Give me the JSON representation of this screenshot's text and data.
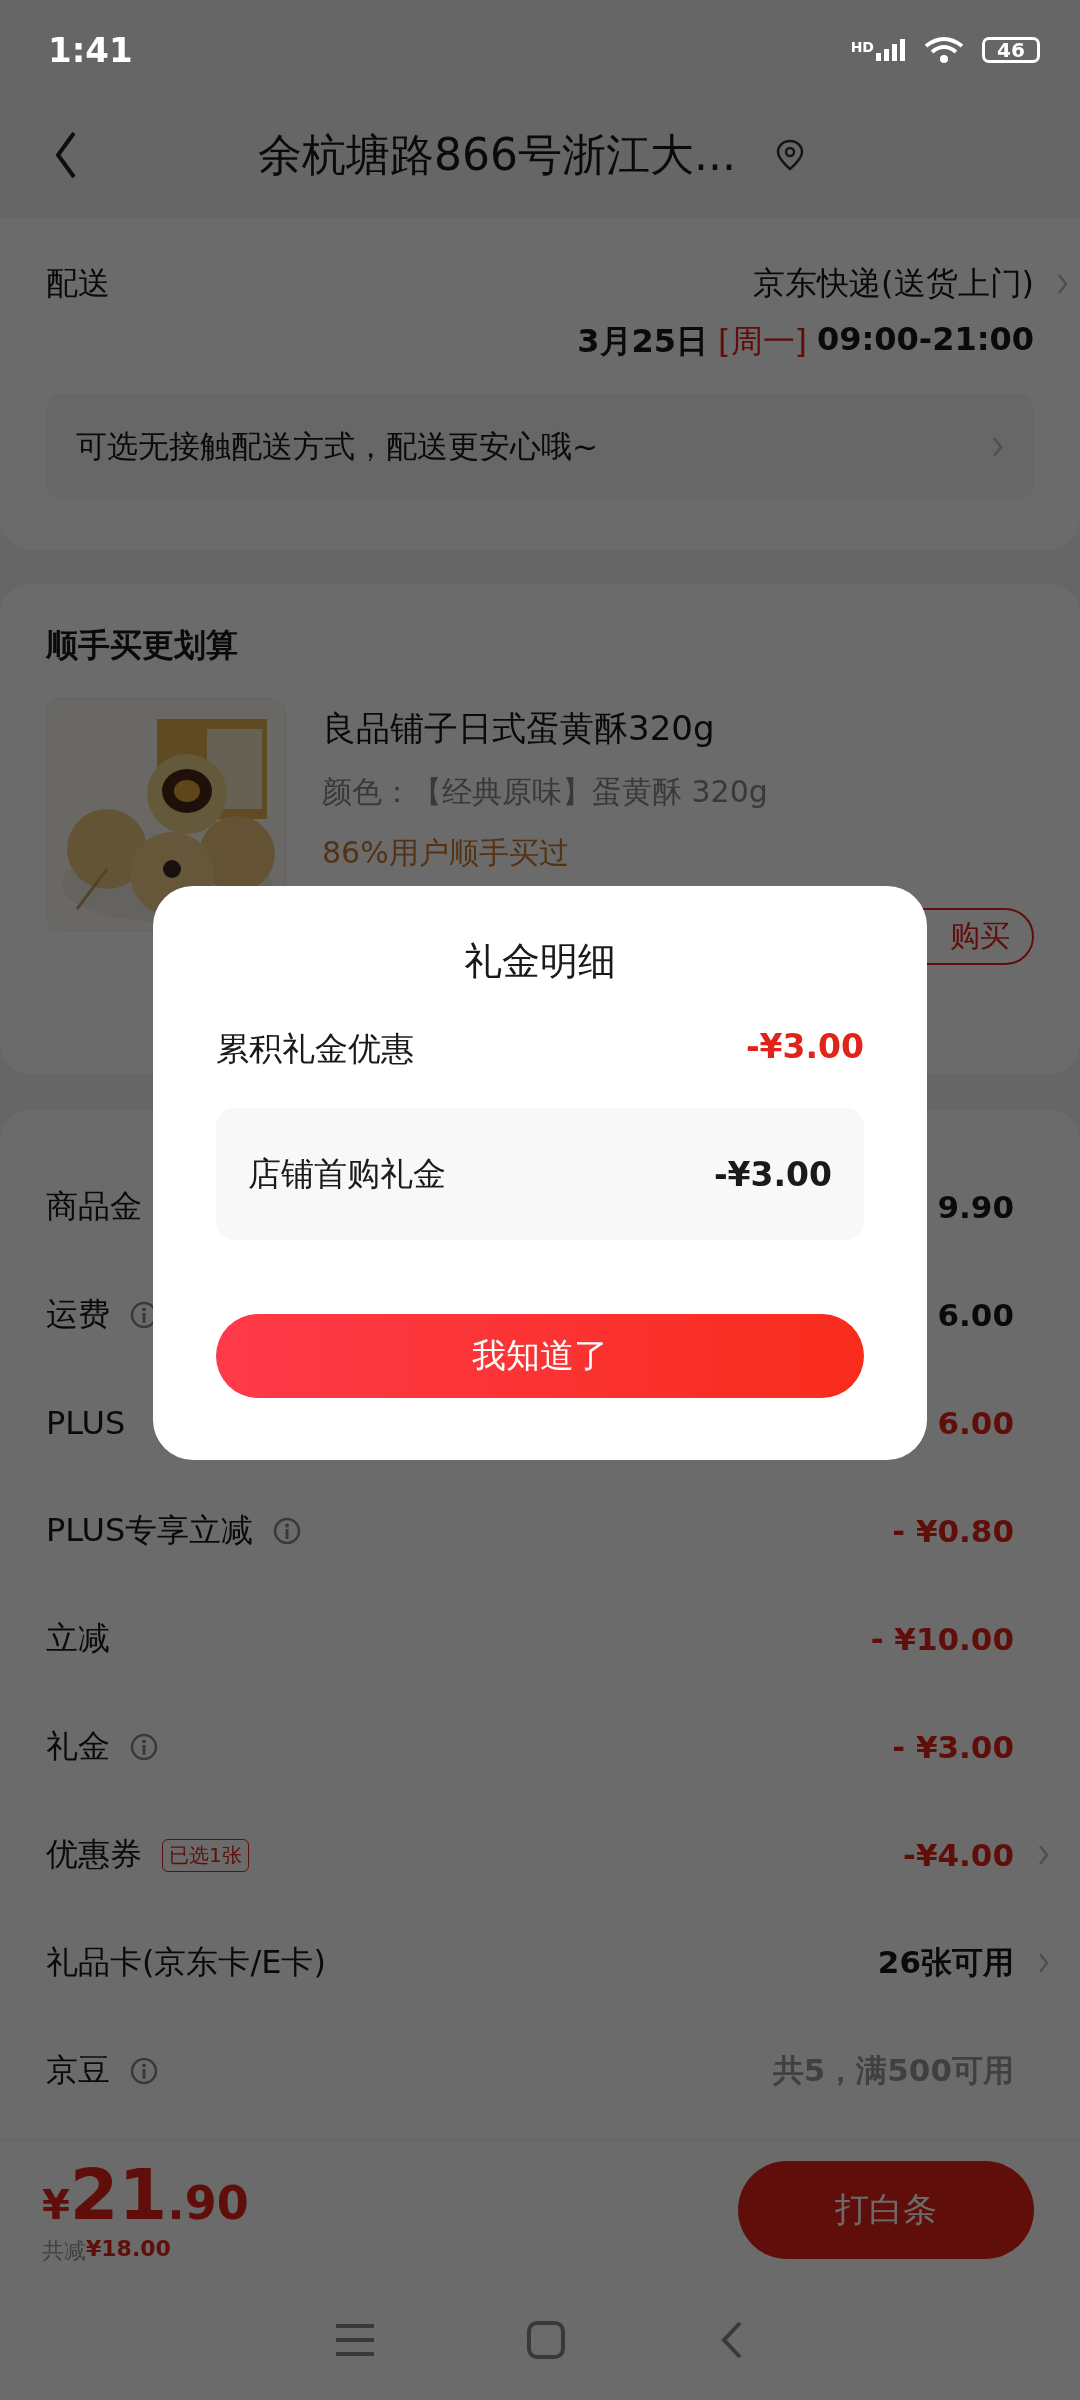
{
  "status_bar": {
    "time": "1:41",
    "network_label": "HD",
    "battery": "46"
  },
  "header": {
    "title": "余杭塘路866号浙江大..."
  },
  "delivery": {
    "label": "配送",
    "carrier": "京东快递(送货上门)",
    "date": "3月25日",
    "weekday": "[周一]",
    "time": "09:00-21:00",
    "notice": "可选无接触配送方式，配送更安心哦~"
  },
  "addon": {
    "title": "顺手买更划算",
    "product": {
      "kind": "picture",
      "name": "良品铺子日式蛋黄酥320g",
      "spec": "颜色：【经典原味】蛋黄酥 320g",
      "note": "86%用户顺手买过",
      "button": "购买"
    }
  },
  "fees": [
    {
      "label": "商品金",
      "value": "9.90",
      "kind": "amount",
      "info": false,
      "chevron": false
    },
    {
      "label": "运费",
      "value": "6.00",
      "kind": "amount",
      "info": true,
      "chevron": false
    },
    {
      "label": "PLUS",
      "value": "6.00",
      "kind": "discount",
      "info": false,
      "chevron": false
    },
    {
      "label": "PLUS专享立减",
      "value": "- ¥0.80",
      "kind": "discount",
      "info": true,
      "chevron": false
    },
    {
      "label": "立减",
      "value": "- ¥10.00",
      "kind": "discount",
      "info": false,
      "chevron": false
    },
    {
      "label": "礼金",
      "value": "- ¥3.00",
      "kind": "discount",
      "info": true,
      "chevron": false
    },
    {
      "label": "优惠券",
      "tag": "已选1张",
      "value": "-¥4.00",
      "kind": "discount",
      "info": false,
      "chevron": true
    },
    {
      "label": "礼品卡(京东卡/E卡)",
      "value": "26张可用",
      "kind": "amount",
      "info": false,
      "chevron": true
    },
    {
      "label": "京豆",
      "value": "共5，满500可用",
      "kind": "hint",
      "info": true,
      "chevron": false
    }
  ],
  "bottom_bar": {
    "currency": "¥",
    "price_int": "21",
    "price_dec": ".90",
    "saved_label": "共减",
    "saved_value": "¥18.00",
    "pay_button": "打白条"
  },
  "dialog": {
    "title": "礼金明细",
    "summary_label": "累积礼金优惠",
    "summary_value": "-¥3.00",
    "items": [
      {
        "label": "店铺首购礼金",
        "value": "-¥3.00"
      }
    ],
    "confirm": "我知道了"
  }
}
